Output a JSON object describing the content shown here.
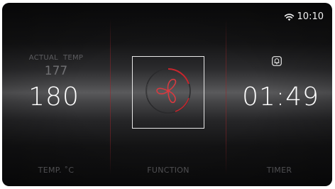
{
  "status_bar": {
    "wifi_icon": "wifi-icon",
    "time": "10:10"
  },
  "temperature": {
    "actual_label": "ACTUAL  TEMP",
    "actual_value": "177",
    "set_value": "180",
    "label": "TEMP. ˚C"
  },
  "function": {
    "icon": "fan-heating-icon",
    "label": "FUNCTION"
  },
  "timer": {
    "icon": "bell-icon",
    "value": "01:49",
    "label": "TIMER"
  },
  "colors": {
    "accent_red": "#c8262d",
    "text_white": "#ffffff",
    "label_grey": "#5d5d60"
  }
}
